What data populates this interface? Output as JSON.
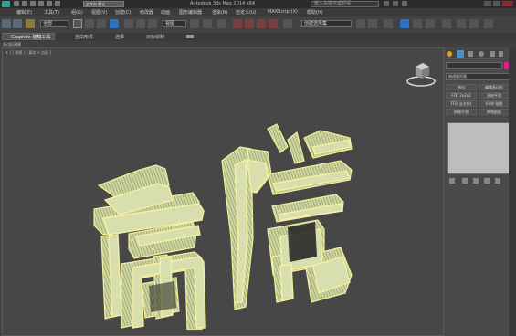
{
  "titlebar": {
    "document_name": "工作台  默认",
    "app_title": "Autodesk 3ds Max  2014 x64",
    "search_placeholder": "键入关键字或短语"
  },
  "menu": [
    "编辑(E)",
    "工具(T)",
    "组(G)",
    "视图(V)",
    "创建(C)",
    "修改器",
    "动画",
    "图形编辑器",
    "渲染(R)",
    "自定义(U)",
    "MAXScript(X)",
    "帮助(H)"
  ],
  "toolbar": {
    "filter_value": "全部",
    "refcoord_value": "视图",
    "selection_set_placeholder": "创建选择集"
  },
  "ribbon": {
    "tabs": [
      "Graphite 建模工具",
      "自由形式",
      "选择",
      "对象绘制"
    ],
    "subtitle": "多边形建模"
  },
  "viewport": {
    "label": "+ ] [ 透视 ] [ 真实 + 边面 ]"
  },
  "command_panel": {
    "name_field": "",
    "modifier_list": "修改器列表",
    "buttons": [
      [
        "挤出",
        "编辑多边形"
      ],
      [
        "FFD 2x2x2",
        "涡轮平滑"
      ],
      [
        "FFD(长方体)",
        "UVW 贴图"
      ],
      [
        "网格平滑",
        "倒角剖面"
      ]
    ]
  },
  "colors": {
    "object_fill": "#d8dfae",
    "object_outline": "#f5f0a0",
    "viewport_bg": "#474747",
    "swatch": "#d4268a"
  }
}
